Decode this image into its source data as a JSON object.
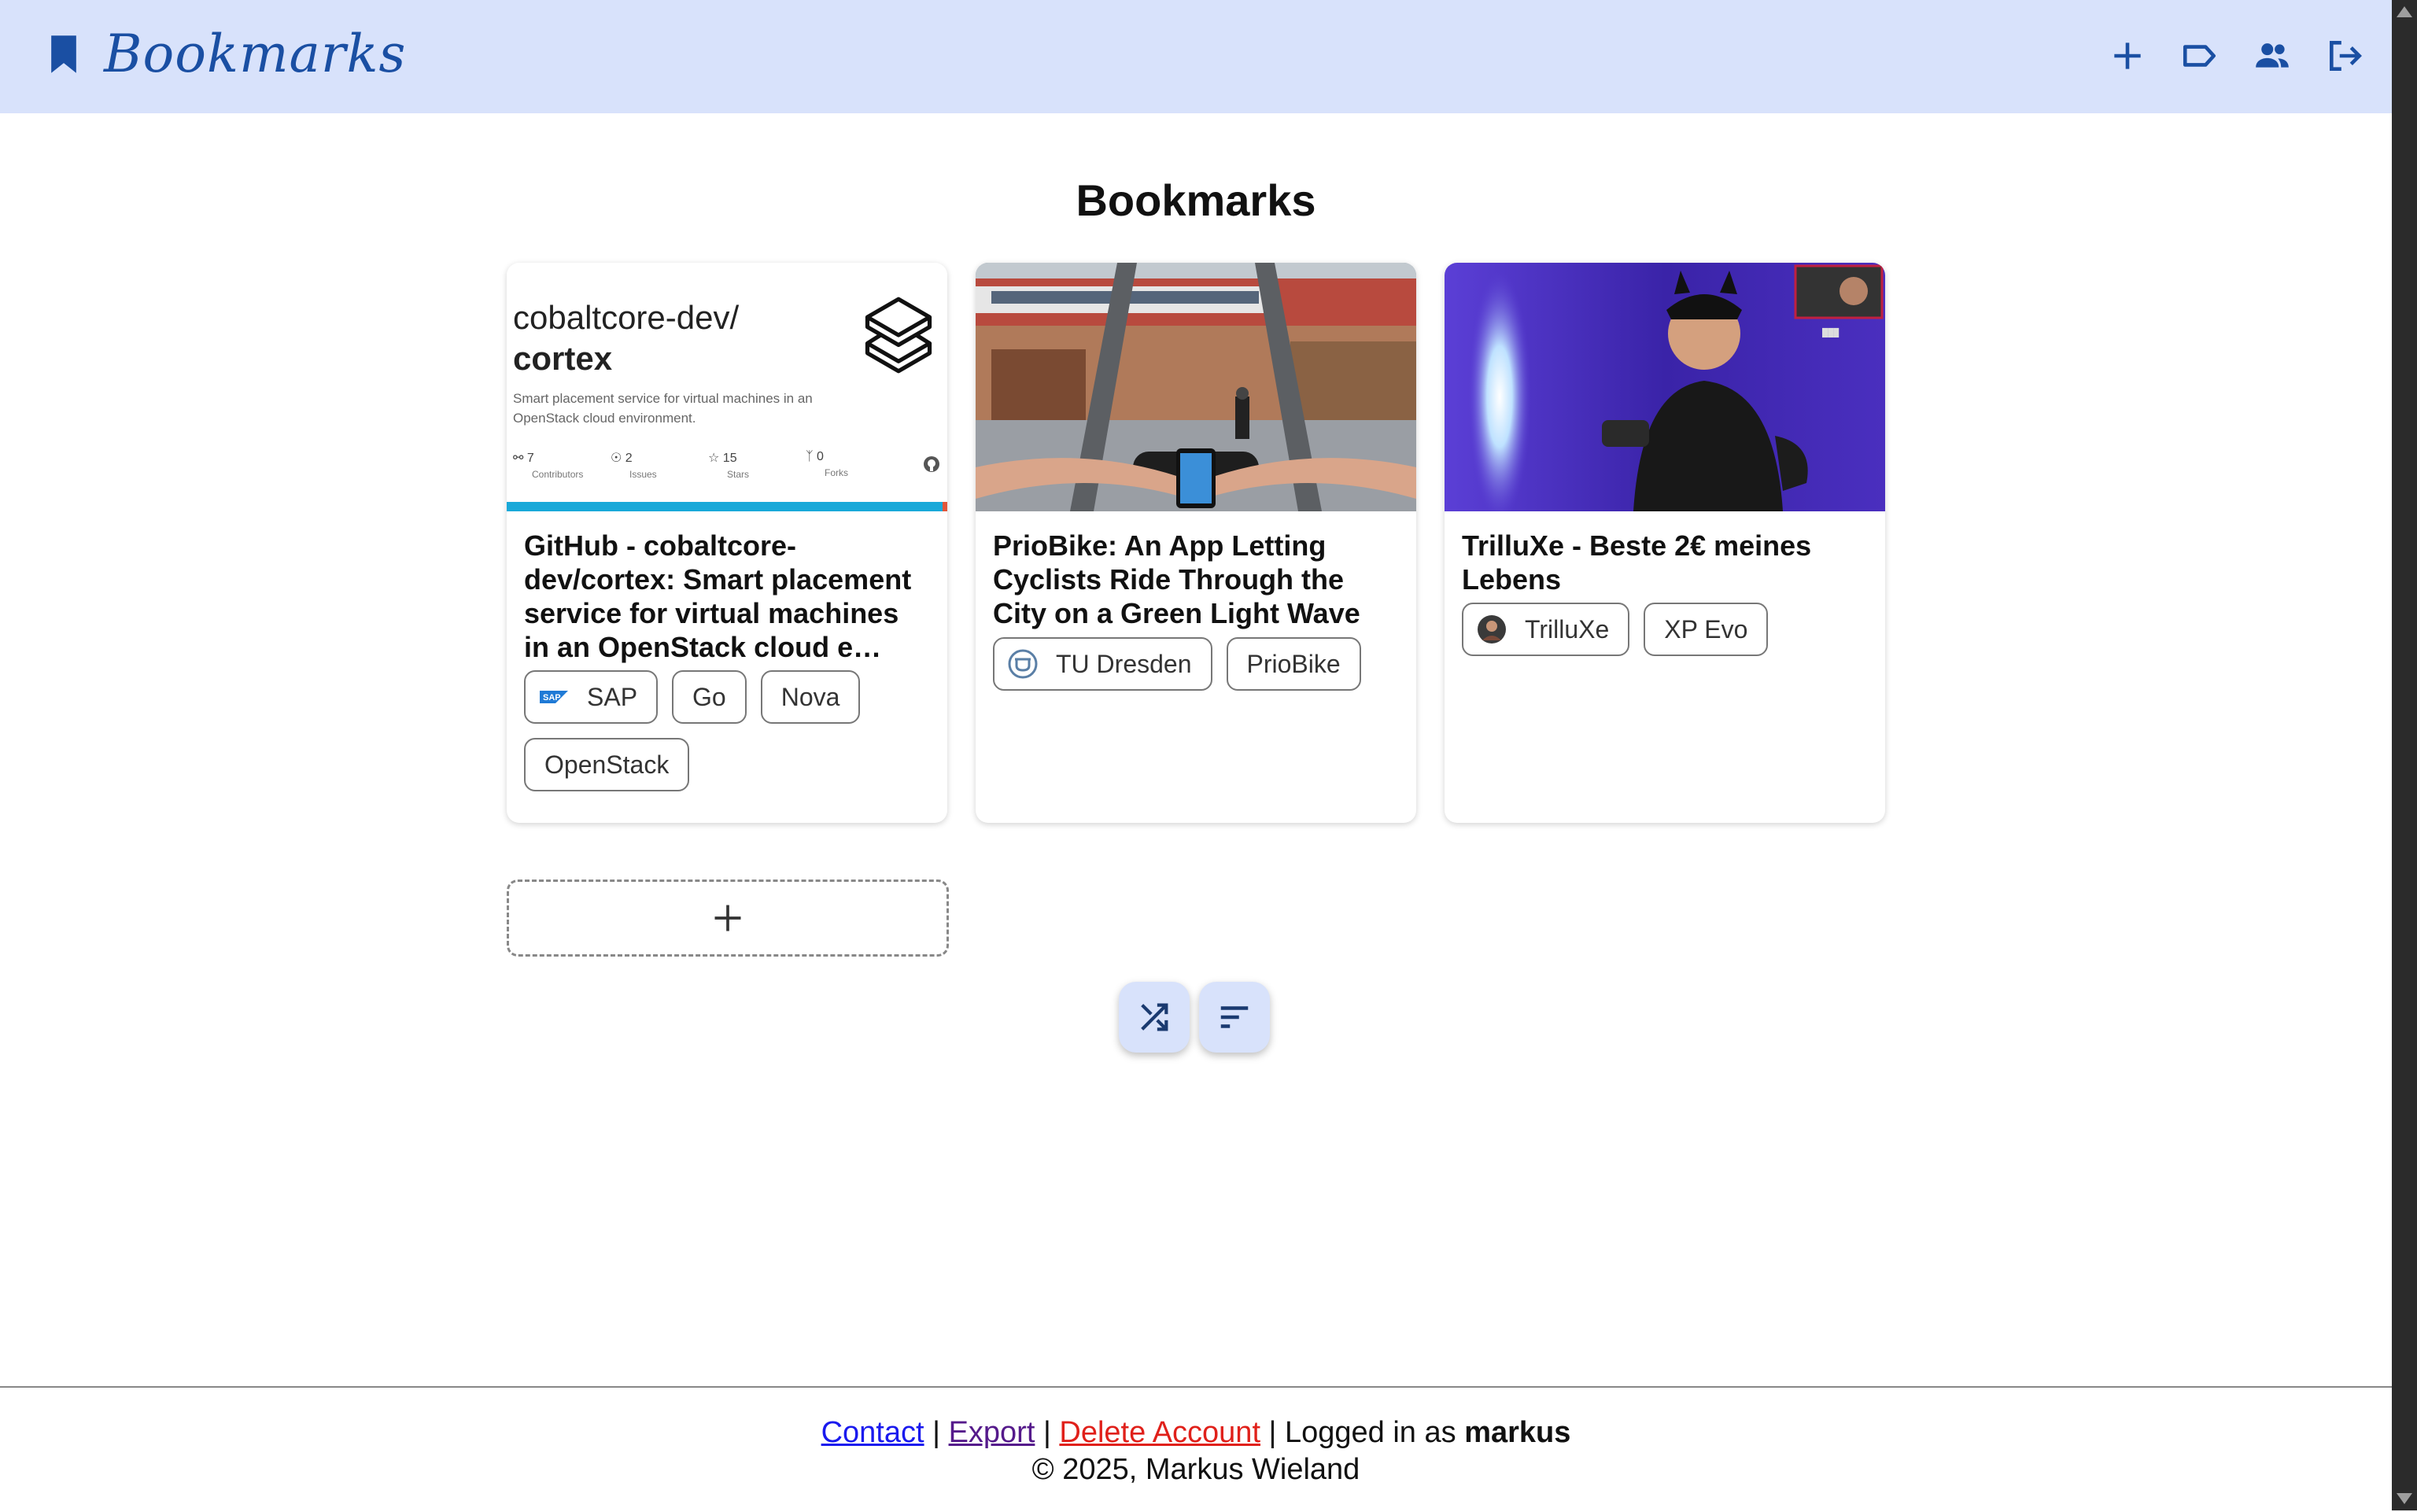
{
  "header": {
    "title": "Bookmarks",
    "icons": [
      "bookmark-icon",
      "plus-icon",
      "label-icon",
      "group-icon",
      "logout-icon"
    ],
    "accent": "#1a4fa3",
    "background": "#d8e2fb"
  },
  "page_title": "Bookmarks",
  "cards": [
    {
      "preview": {
        "repo_owner": "cobaltcore-dev/",
        "repo_name": "cortex",
        "description": "Smart placement service for virtual machines in an OpenStack cloud environment.",
        "stats": [
          {
            "value": "7",
            "label": "Contributors",
            "icon": "people-icon"
          },
          {
            "value": "2",
            "label": "Issues",
            "icon": "issue-icon"
          },
          {
            "value": "15",
            "label": "Stars",
            "icon": "star-icon"
          },
          {
            "value": "0",
            "label": "Forks",
            "icon": "fork-icon"
          }
        ]
      },
      "title": "GitHub - cobaltcore-dev/cortex: Smart placement service for virtual machines in an OpenStack cloud e…",
      "tags": [
        {
          "label": "SAP",
          "icon": "sap-logo-icon"
        },
        {
          "label": "Go"
        },
        {
          "label": "Nova"
        },
        {
          "label": "OpenStack"
        }
      ]
    },
    {
      "title": "PrioBike: An App Letting Cyclists Ride Through the City on a Green Light Wave",
      "image": "cyclist-handlebar-photo",
      "tags": [
        {
          "label": "TU Dresden",
          "icon": "tu-dresden-logo-icon"
        },
        {
          "label": "PrioBike"
        }
      ]
    },
    {
      "title": "TrilluXe - Beste 2€ meines Lebens",
      "image": "video-thumbnail-photo",
      "tags": [
        {
          "label": "TrilluXe",
          "icon": "avatar-icon"
        },
        {
          "label": "XP Evo"
        }
      ]
    }
  ],
  "actions": {
    "add": "plus-icon",
    "shuffle": "shuffle-icon",
    "sort": "sort-icon"
  },
  "footer": {
    "contact": "Contact",
    "export": "Export",
    "delete_account": "Delete Account",
    "separator": " | ",
    "logged_in_prefix": "Logged in as ",
    "username": "markus",
    "copyright": "© 2025, Markus Wieland"
  }
}
